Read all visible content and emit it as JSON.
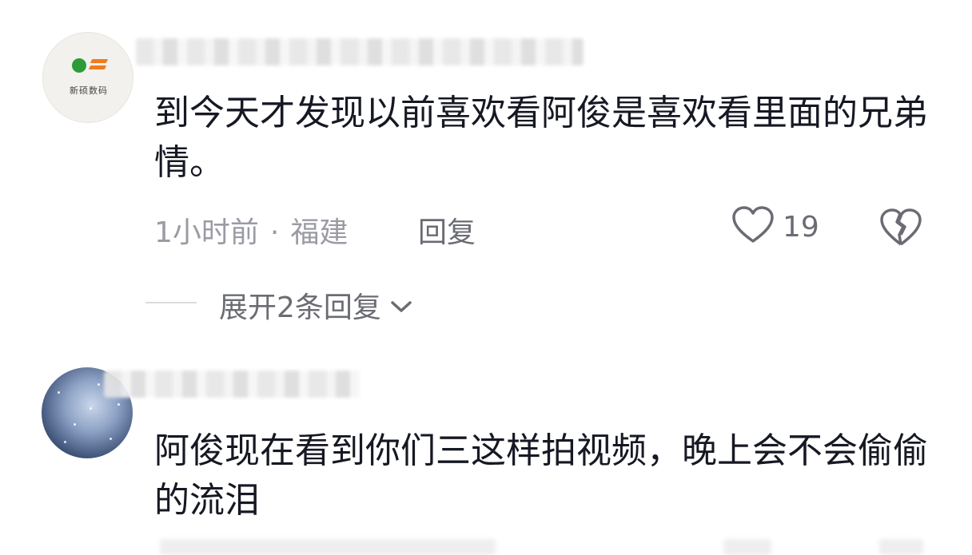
{
  "comments": [
    {
      "avatar_text": "新硕数码",
      "content": "到今天才发现以前喜欢看阿俊是喜欢看里面的兄弟情。",
      "time": "1小时前",
      "separator": "·",
      "location": "福建",
      "reply_label": "回复",
      "like_count": "19",
      "expand_label": "展开2条回复"
    },
    {
      "content": "阿俊现在看到你们三这样拍视频，晚上会不会偷偷的流泪"
    }
  ],
  "colors": {
    "text_primary": "#161823",
    "text_secondary": "#9a9ba3",
    "action_gray": "#6b6c73",
    "logo_green": "#2e9b3a",
    "logo_orange": "#f07c1e"
  },
  "icons": [
    "heart-outline-icon",
    "broken-heart-icon",
    "chevron-down-icon"
  ]
}
